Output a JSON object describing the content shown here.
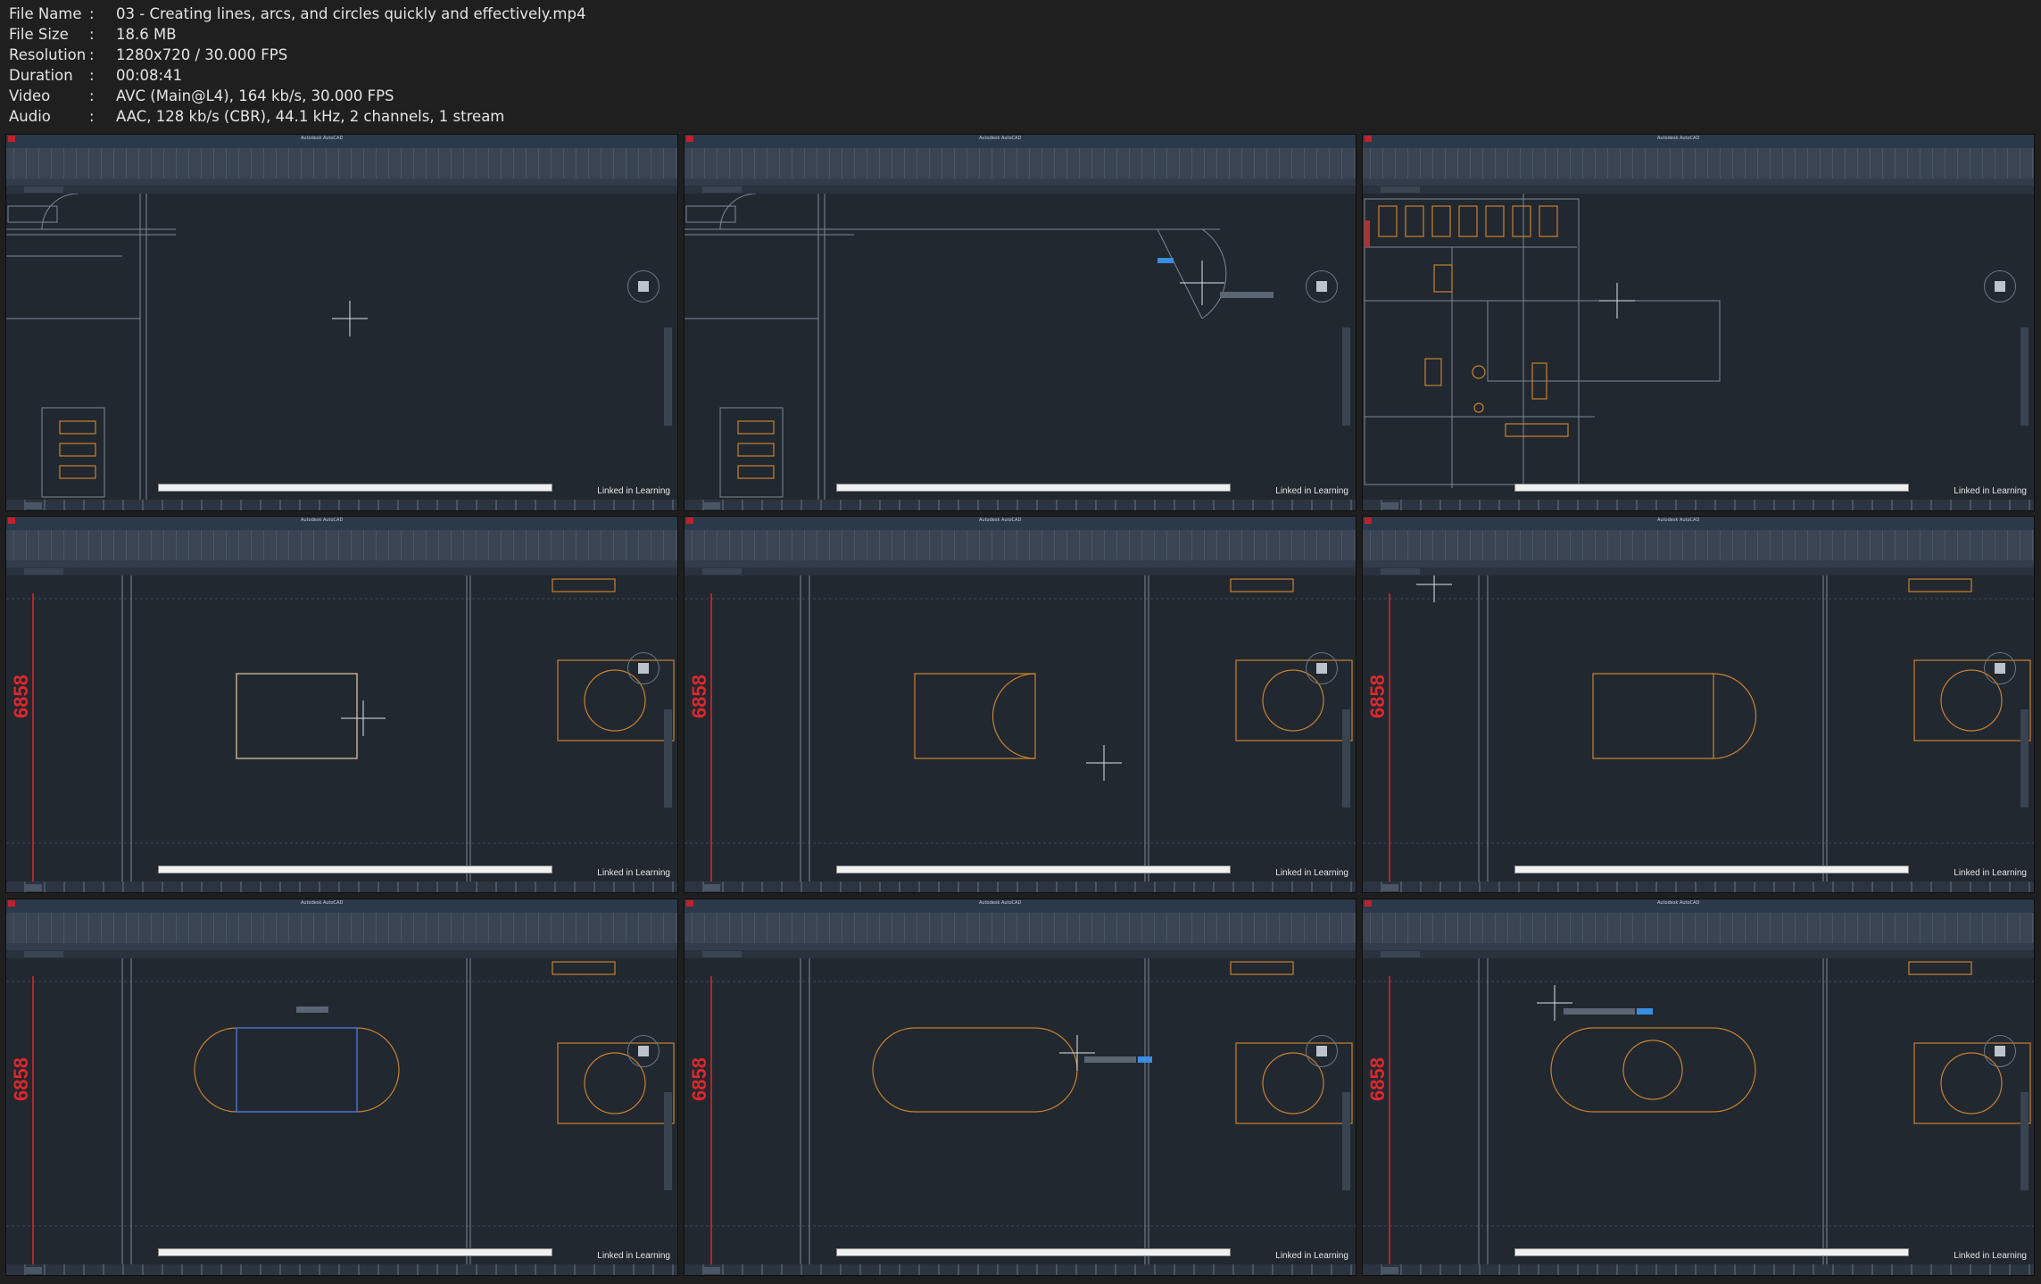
{
  "file_info": {
    "file_name_label": "File Name",
    "file_name": "03 - Creating lines, arcs, and circles quickly and effectively.mp4",
    "file_size_label": "File Size",
    "file_size": "18.6 MB",
    "resolution_label": "Resolution",
    "resolution": "1280x720 / 30.000 FPS",
    "duration_label": "Duration",
    "duration": "00:08:41",
    "video_label": "Video",
    "video": "AVC (Main@L4), 164 kb/s, 30.000 FPS",
    "audio_label": "Audio",
    "audio": "AAC, 128 kb/s (CBR), 44.1 kHz, 2 channels, 1 stream",
    "separator": ":"
  },
  "app": {
    "name": "Autodesk AutoCAD",
    "watermark": "Linked in Learning",
    "dimension_label": "6858",
    "colors": {
      "canvas": "#212830",
      "geometry": "#c8812f",
      "dimension": "#e0262b",
      "grid": "#3d4a5a"
    }
  }
}
